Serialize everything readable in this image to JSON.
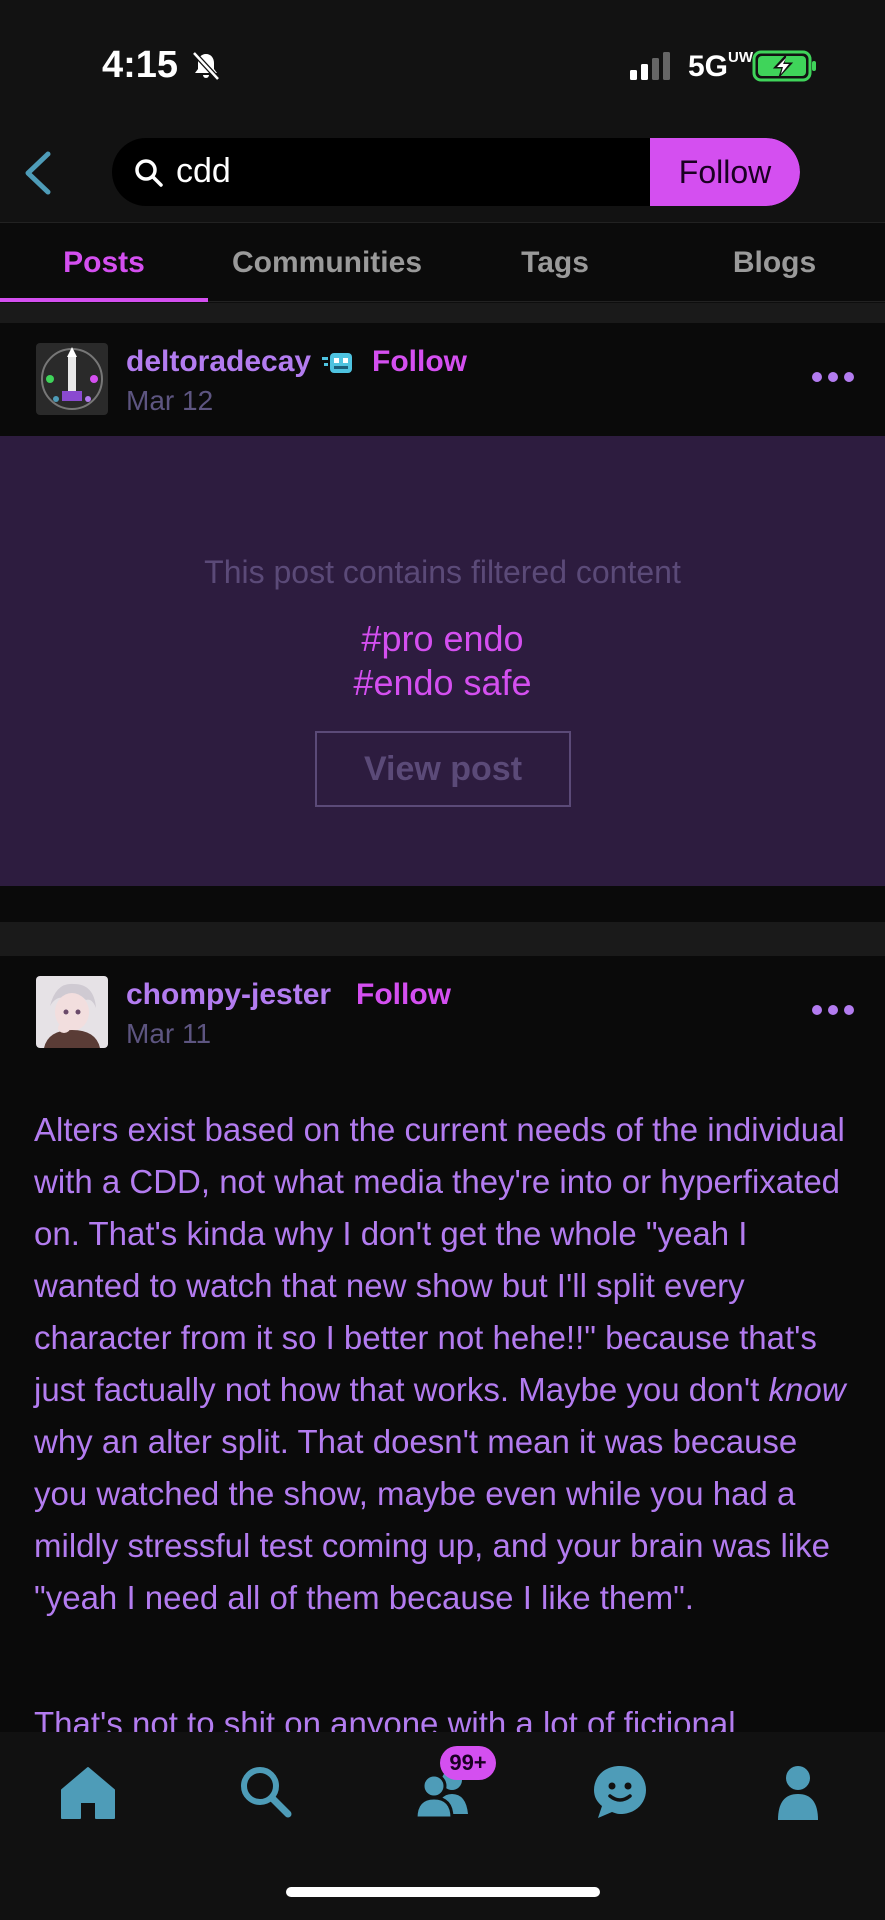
{
  "status_bar": {
    "time": "4:15",
    "network": "5G",
    "network_sub": "UW"
  },
  "search": {
    "query": "cdd",
    "follow_label": "Follow"
  },
  "tabs": [
    {
      "label": "Posts",
      "active": true
    },
    {
      "label": "Communities",
      "active": false
    },
    {
      "label": "Tags",
      "active": false
    },
    {
      "label": "Blogs",
      "active": false
    }
  ],
  "posts": [
    {
      "username": "deltoradecay",
      "follow_label": "Follow",
      "date": "Mar 12",
      "filtered_message": "This post contains filtered content",
      "tags": [
        "#pro endo",
        "#endo safe"
      ],
      "view_post_label": "View post"
    },
    {
      "username": "chompy-jester",
      "follow_label": "Follow",
      "date": "Mar 11",
      "body": {
        "p1_before": "Alters exist based on the current needs of the individual with a CDD, not what media they're into or hyperfixated on. That's kinda why I don't get the whole \"yeah I wanted to watch that new show but I'll split every character from it so I better not hehe!!\" because that's just factually not how that works. Maybe you don't ",
        "p1_em": "know",
        "p1_after": " why an alter split. That doesn't mean it was because you watched the show, maybe even while you had a mildly stressful test coming up, and your brain was like \"yeah I need all of them because I like them\".",
        "p2": "That's not to shit on anyone with a lot of fictional"
      }
    }
  ],
  "nav": {
    "badge": "99+"
  },
  "colors": {
    "accent": "#d44ff0",
    "text_purple": "#b37cf0",
    "filtered_bg": "#2d1c3f",
    "icon_teal": "#4e9cb8"
  },
  "icons": [
    "bell-muted-icon",
    "signal-icon",
    "battery-charging-icon",
    "back-chevron-icon",
    "search-icon",
    "more-icon",
    "home-icon",
    "search-nav-icon",
    "people-icon",
    "chat-icon",
    "profile-icon"
  ]
}
